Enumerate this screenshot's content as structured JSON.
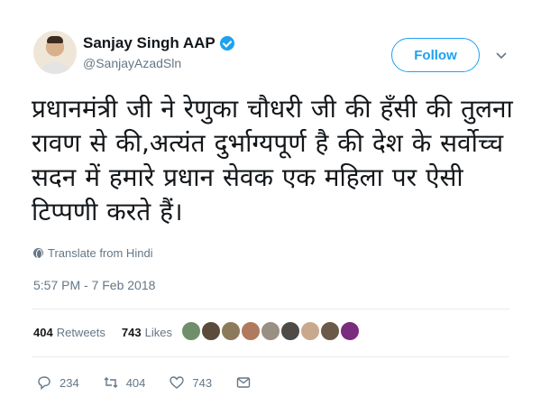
{
  "tweet": {
    "author": {
      "display_name": "Sanjay Singh AAP",
      "handle": "@SanjayAzadSln",
      "verified": true
    },
    "follow_label": "Follow",
    "text": "प्रधानमंत्री जी ने रेणुका चौधरी जी की हँसी की तुलना रावण से की,अत्यंत दुर्भाग्यपूर्ण है की देश के सर्वोच्च सदन में हमारे प्रधान सेवक एक महिला पर ऐसी टिप्पणी करते हैं।",
    "translate_label": "Translate from Hindi",
    "timestamp": "5:57 PM - 7 Feb 2018",
    "stats": {
      "retweets_count": "404",
      "retweets_label": "Retweets",
      "likes_count": "743",
      "likes_label": "Likes"
    },
    "likers": [
      "#6f8f6a",
      "#5c4a3b",
      "#8d7a5d",
      "#b07a5e",
      "#9a8f83",
      "#4e4a47",
      "#c9a98d",
      "#6b5a4a",
      "#7a2c7e"
    ],
    "actions": {
      "replies": "234",
      "retweets": "404",
      "likes": "743"
    },
    "colors": {
      "accent": "#1da1f2",
      "muted": "#657786",
      "text": "#14171a"
    }
  }
}
